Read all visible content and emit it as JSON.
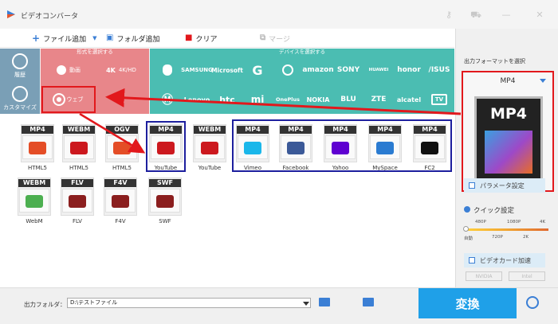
{
  "app": {
    "title": "ビデオコンバータ"
  },
  "toolbar": {
    "add_file": "ファイル追加",
    "add_folder": "フォルダ追加",
    "clear": "クリア",
    "merge": "マージ"
  },
  "sidebar": {
    "history": "履歴",
    "custom": "カスタマイズ"
  },
  "format_section": {
    "header": "形式を選択する",
    "tiles": [
      {
        "label": "動画"
      },
      {
        "label": "4K/HD"
      },
      {
        "label": "ウェブ"
      },
      {
        "label": ""
      }
    ]
  },
  "device_section": {
    "header": "デバイスを選択する",
    "row1": [
      "",
      "SAMSUNG",
      "Microsoft",
      "G",
      "",
      "amazon",
      "SONY",
      "HUAWEI",
      "honor",
      "/ISUS"
    ],
    "row2": [
      "",
      "Lenovo",
      "htc",
      "mi",
      "OnePlus",
      "NOKIA",
      "BLU",
      "ZTE",
      "alcatel",
      "TV"
    ]
  },
  "formats": [
    {
      "badge": "MP4",
      "label": "HTML5",
      "accent": "#e44d26"
    },
    {
      "badge": "WEBM",
      "label": "HTML5",
      "accent": "#cc181e"
    },
    {
      "badge": "OGV",
      "label": "HTML5",
      "accent": "#e44d26"
    },
    {
      "badge": "MP4",
      "label": "YouTube",
      "accent": "#cc181e"
    },
    {
      "badge": "WEBM",
      "label": "YouTube",
      "accent": "#cc181e"
    },
    {
      "badge": "MP4",
      "label": "Vimeo",
      "accent": "#1ab7ea"
    },
    {
      "badge": "MP4",
      "label": "Facebook",
      "accent": "#3b5998"
    },
    {
      "badge": "MP4",
      "label": "Yahoo",
      "accent": "#5f01d1"
    },
    {
      "badge": "MP4",
      "label": "MySpace",
      "accent": "#2a7bd1"
    },
    {
      "badge": "MP4",
      "label": "FC2",
      "accent": "#111111"
    },
    {
      "badge": "WEBM",
      "label": "WebM",
      "accent": "#4caf50"
    },
    {
      "badge": "FLV",
      "label": "FLV",
      "accent": "#8b1e1e"
    },
    {
      "badge": "F4V",
      "label": "F4V",
      "accent": "#8b1e1e"
    },
    {
      "badge": "SWF",
      "label": "SWF",
      "accent": "#8b1e1e"
    }
  ],
  "right_panel": {
    "output_format_label": "出力フォーマットを選択",
    "selected_format": "MP4",
    "preview_badge": "MP4",
    "param_button": "パラメータ設定",
    "quick_settings": "クイック設定",
    "quality_top": [
      "480P",
      "1080P",
      "4K"
    ],
    "quality_bottom": [
      "自動",
      "720P",
      "2K"
    ],
    "gpu_button": "ビデオカード加速",
    "hw": [
      "NVIDIA",
      "Intel"
    ]
  },
  "bottom": {
    "output_folder_label": "出力フォルダ：",
    "output_folder_value": "D:\\テストファイル",
    "convert_button": "変換"
  },
  "colors": {
    "highlight_red": "#e2181c",
    "highlight_blue": "#1d1f9e",
    "convert_blue": "#1fa0e8",
    "format_pink": "#e8868a",
    "device_teal": "#4bbdb2"
  }
}
